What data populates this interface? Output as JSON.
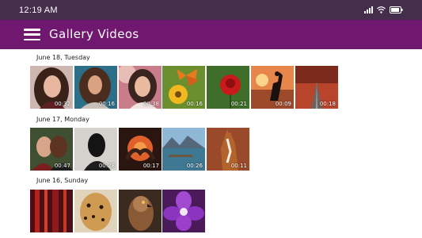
{
  "status_bar": {
    "time": "12:19 AM",
    "icons": [
      "signal-icon",
      "wifi-icon",
      "battery-icon"
    ]
  },
  "app_bar": {
    "title": "Gallery Videos",
    "menu_icon": "hamburger-menu-icon",
    "color": "#70186f"
  },
  "groups": [
    {
      "date": "June 18, Tuesday",
      "videos": [
        {
          "subject": "woman-portrait",
          "duration": "00:32"
        },
        {
          "subject": "woman-curly-hair",
          "duration": "00:16"
        },
        {
          "subject": "woman-smiling-sunlight",
          "duration": "00:38"
        },
        {
          "subject": "butterfly-on-flower",
          "duration": "00:16"
        },
        {
          "subject": "red-rose",
          "duration": "00:21"
        },
        {
          "subject": "dancing-couple-sunset",
          "duration": "00:09"
        },
        {
          "subject": "autumn-road",
          "duration": "00:18"
        }
      ]
    },
    {
      "date": "June 17, Monday",
      "videos": [
        {
          "subject": "couple",
          "duration": "00:47"
        },
        {
          "subject": "woman-back-view",
          "duration": "00:28"
        },
        {
          "subject": "hands-heart-shape",
          "duration": "00:17"
        },
        {
          "subject": "mountain-lake",
          "duration": "00:26"
        },
        {
          "subject": "horse",
          "duration": "00:11"
        }
      ]
    },
    {
      "date": "June 16, Sunday",
      "videos": [
        {
          "subject": "abstract-red-stripes",
          "duration": ""
        },
        {
          "subject": "leopard",
          "duration": ""
        },
        {
          "subject": "hawk",
          "duration": ""
        },
        {
          "subject": "purple-flower",
          "duration": ""
        }
      ]
    }
  ]
}
